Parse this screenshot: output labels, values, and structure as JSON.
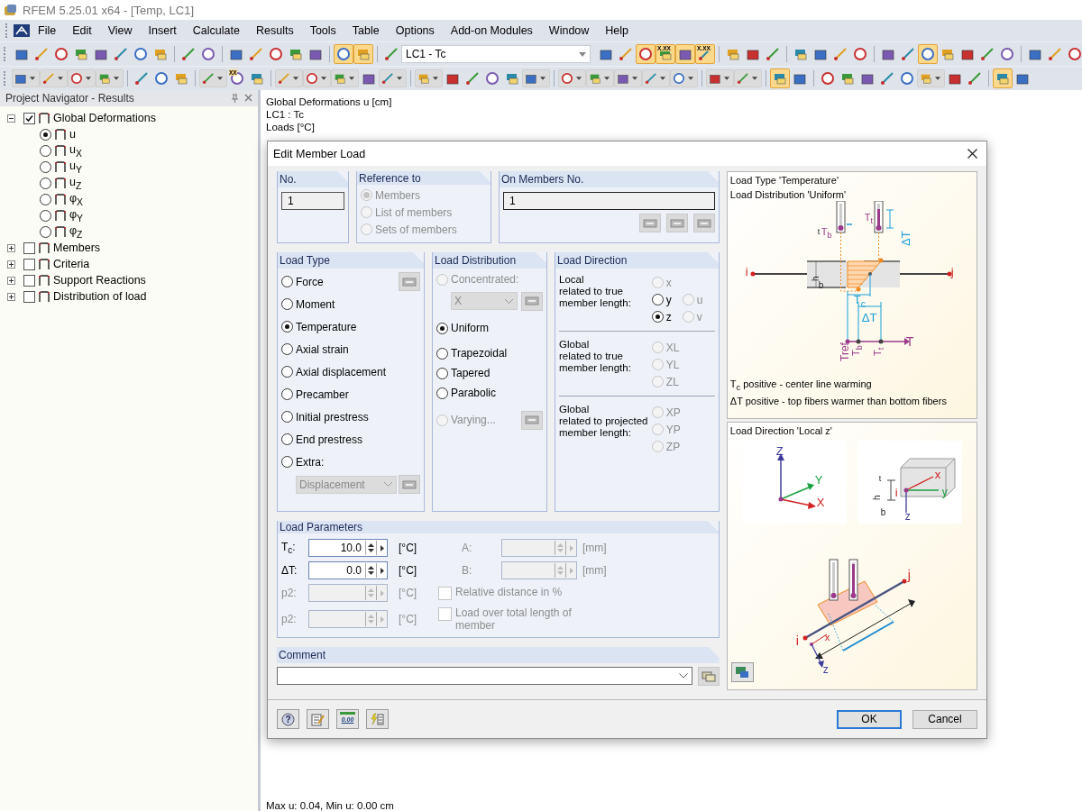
{
  "window": {
    "title": "RFEM 5.25.01 x64 - [Temp, LC1]"
  },
  "menu": [
    "File",
    "Edit",
    "View",
    "Insert",
    "Calculate",
    "Results",
    "Tools",
    "Table",
    "Options",
    "Add-on Modules",
    "Window",
    "Help"
  ],
  "toolbar_1": {
    "before": [
      {
        "kind": "button",
        "pressed": false
      },
      {
        "kind": "button",
        "pressed": false
      },
      {
        "kind": "button",
        "pressed": false
      },
      {
        "kind": "button",
        "pressed": false
      },
      {
        "kind": "button",
        "pressed": false
      },
      {
        "kind": "button",
        "pressed": false
      },
      {
        "kind": "button",
        "pressed": false
      },
      {
        "kind": "button",
        "pressed": false
      },
      {
        "kind": "separator"
      },
      {
        "kind": "button",
        "pressed": false
      },
      {
        "kind": "button",
        "pressed": false
      },
      {
        "kind": "separator"
      },
      {
        "kind": "button",
        "pressed": false
      },
      {
        "kind": "button",
        "pressed": false
      },
      {
        "kind": "button",
        "pressed": false
      },
      {
        "kind": "button",
        "pressed": false
      },
      {
        "kind": "button",
        "pressed": false
      },
      {
        "kind": "separator"
      },
      {
        "kind": "button",
        "pressed": true
      },
      {
        "kind": "button",
        "pressed": true
      },
      {
        "kind": "separator"
      },
      {
        "kind": "button",
        "pressed": false
      }
    ],
    "load_case": "LC1 - Tc",
    "after": [
      {
        "kind": "button",
        "pressed": false
      },
      {
        "kind": "button",
        "pressed": false
      },
      {
        "kind": "button",
        "pressed": true
      },
      {
        "kind": "button",
        "pressed": true,
        "text": "X.XX"
      },
      {
        "kind": "button",
        "pressed": true
      },
      {
        "kind": "button",
        "pressed": true,
        "text": "X.XX"
      },
      {
        "kind": "separator"
      },
      {
        "kind": "button",
        "pressed": false
      },
      {
        "kind": "button",
        "pressed": false
      },
      {
        "kind": "button",
        "pressed": false
      },
      {
        "kind": "separator"
      },
      {
        "kind": "button",
        "pressed": false
      },
      {
        "kind": "button",
        "pressed": false
      },
      {
        "kind": "button",
        "pressed": false
      },
      {
        "kind": "button",
        "pressed": false
      },
      {
        "kind": "separator"
      },
      {
        "kind": "button",
        "pressed": false
      },
      {
        "kind": "button",
        "pressed": false
      },
      {
        "kind": "button",
        "pressed": true
      },
      {
        "kind": "button",
        "pressed": false
      },
      {
        "kind": "button",
        "pressed": false
      },
      {
        "kind": "button",
        "pressed": false
      },
      {
        "kind": "button",
        "pressed": false
      },
      {
        "kind": "separator"
      },
      {
        "kind": "button",
        "pressed": false
      },
      {
        "kind": "button",
        "pressed": false
      },
      {
        "kind": "button",
        "pressed": false
      }
    ]
  },
  "toolbar_2": [
    {
      "kind": "dropdown",
      "pressed": false
    },
    {
      "kind": "dropdown",
      "pressed": false
    },
    {
      "kind": "dropdown",
      "pressed": false
    },
    {
      "kind": "dropdown",
      "pressed": false
    },
    {
      "kind": "separator"
    },
    {
      "kind": "button",
      "pressed": false
    },
    {
      "kind": "button",
      "pressed": false
    },
    {
      "kind": "button",
      "pressed": false
    },
    {
      "kind": "separator"
    },
    {
      "kind": "dropdown",
      "pressed": false
    },
    {
      "kind": "button",
      "pressed": false,
      "text": "XX"
    },
    {
      "kind": "button",
      "pressed": false
    },
    {
      "kind": "separator"
    },
    {
      "kind": "dropdown",
      "pressed": false
    },
    {
      "kind": "dropdown",
      "pressed": false
    },
    {
      "kind": "dropdown",
      "pressed": false
    },
    {
      "kind": "button",
      "pressed": false
    },
    {
      "kind": "dropdown",
      "pressed": false
    },
    {
      "kind": "separator"
    },
    {
      "kind": "dropdown",
      "pressed": false
    },
    {
      "kind": "button",
      "pressed": false
    },
    {
      "kind": "button",
      "pressed": false
    },
    {
      "kind": "button",
      "pressed": false
    },
    {
      "kind": "button",
      "pressed": false
    },
    {
      "kind": "dropdown",
      "pressed": false
    },
    {
      "kind": "separator"
    },
    {
      "kind": "dropdown",
      "pressed": false
    },
    {
      "kind": "dropdown",
      "pressed": false
    },
    {
      "kind": "dropdown",
      "pressed": false
    },
    {
      "kind": "dropdown",
      "pressed": false
    },
    {
      "kind": "dropdown",
      "pressed": false
    },
    {
      "kind": "separator"
    },
    {
      "kind": "dropdown",
      "pressed": false
    },
    {
      "kind": "dropdown",
      "pressed": false
    },
    {
      "kind": "separator"
    },
    {
      "kind": "button",
      "pressed": true
    },
    {
      "kind": "button",
      "pressed": false
    },
    {
      "kind": "separator"
    },
    {
      "kind": "button",
      "pressed": false
    },
    {
      "kind": "button",
      "pressed": false
    },
    {
      "kind": "button",
      "pressed": false
    },
    {
      "kind": "button",
      "pressed": false
    },
    {
      "kind": "button",
      "pressed": false
    },
    {
      "kind": "dropdown",
      "pressed": false
    },
    {
      "kind": "button",
      "pressed": false
    },
    {
      "kind": "button",
      "pressed": false
    },
    {
      "kind": "separator"
    },
    {
      "kind": "button",
      "pressed": true
    },
    {
      "kind": "button",
      "pressed": false
    }
  ],
  "navigator": {
    "title": "Project Navigator - Results",
    "tree": [
      {
        "label": "Global Deformations",
        "checked": true,
        "expanded": true,
        "children": [
          {
            "label": "u",
            "selected": true
          },
          {
            "label": "u$_{X}$",
            "selected": false
          },
          {
            "label": "u$_{Y}$",
            "selected": false
          },
          {
            "label": "u$_{Z}$",
            "selected": false
          },
          {
            "label": "φ$_{X}$",
            "selected": false
          },
          {
            "label": "φ$_{Y}$",
            "selected": false
          },
          {
            "label": "φ$_{Z}$",
            "selected": false
          }
        ]
      },
      {
        "label": "Members",
        "checked": false,
        "expanded": false
      },
      {
        "label": "Criteria",
        "checked": false,
        "expanded": false
      },
      {
        "label": "Support Reactions",
        "checked": false,
        "expanded": false
      },
      {
        "label": "Distribution of load",
        "checked": false,
        "expanded": false
      }
    ]
  },
  "view": {
    "lines": [
      "Global Deformations u [cm]",
      "LC1 : Tc",
      "Loads [°C]"
    ],
    "status": "Max u: 0.04, Min u: 0.00 cm"
  },
  "dialog": {
    "title": "Edit Member Load",
    "no": {
      "title": "No.",
      "value": "1"
    },
    "reference": {
      "title": "Reference to",
      "items": [
        {
          "label": "Members",
          "selected": true,
          "disabled": true
        },
        {
          "label": "List of members",
          "selected": false,
          "disabled": true
        },
        {
          "label": "Sets of members",
          "selected": false,
          "disabled": true
        }
      ]
    },
    "members": {
      "title": "On Members No.",
      "value": "1"
    },
    "load_type": {
      "title": "Load Type",
      "items": [
        {
          "kind": "radio",
          "label": "Force",
          "selected": false,
          "disabled": false
        },
        {
          "kind": "radio",
          "label": "Moment",
          "selected": false,
          "disabled": false
        },
        {
          "kind": "radio",
          "label": "Temperature",
          "selected": true,
          "disabled": false
        },
        {
          "kind": "radio",
          "label": "Axial strain",
          "selected": false,
          "disabled": false
        },
        {
          "kind": "radio",
          "label": "Axial displacement",
          "selected": false,
          "disabled": false
        },
        {
          "kind": "radio",
          "label": "Precamber",
          "selected": false,
          "disabled": false
        },
        {
          "kind": "radio",
          "label": "Initial prestress",
          "selected": false,
          "disabled": false
        },
        {
          "kind": "radio",
          "label": "End prestress",
          "selected": false,
          "disabled": false
        },
        {
          "kind": "radio",
          "label": "Extra:",
          "selected": false,
          "disabled": false
        },
        {
          "kind": "dropdown",
          "value": "Displacement",
          "disabled": true
        }
      ]
    },
    "load_distribution": {
      "title": "Load Distribution",
      "items": [
        {
          "kind": "radio",
          "label": "Concentrated:",
          "selected": false,
          "disabled": true
        },
        {
          "kind": "dropdown",
          "value": "X",
          "disabled": true
        },
        {
          "kind": "radio",
          "label": "Uniform",
          "selected": true,
          "disabled": false
        },
        {
          "kind": "radio",
          "label": "Trapezoidal",
          "selected": false,
          "disabled": false
        },
        {
          "kind": "radio",
          "label": "Tapered",
          "selected": false,
          "disabled": false
        },
        {
          "kind": "radio",
          "label": "Parabolic",
          "selected": false,
          "disabled": false
        },
        {
          "kind": "radio",
          "label": "Varying...",
          "selected": false,
          "disabled": true
        }
      ]
    },
    "load_direction": {
      "title": "Load Direction",
      "groups": [
        {
          "label": "Local\nrelated to true\nmember length:",
          "columns": [
            [
              {
                "label": "x",
                "selected": false,
                "disabled": true
              },
              {
                "label": "y",
                "selected": false,
                "disabled": false
              },
              {
                "label": "z",
                "selected": true,
                "disabled": false
              }
            ],
            [
              {
                "label": "u",
                "selected": false,
                "disabled": true
              },
              {
                "label": "v",
                "selected": false,
                "disabled": true
              }
            ]
          ]
        },
        {
          "label": "Global\nrelated to true\nmember length:",
          "columns": [
            [
              {
                "label": "XL",
                "selected": false,
                "disabled": true
              },
              {
                "label": "YL",
                "selected": false,
                "disabled": true
              },
              {
                "label": "ZL",
                "selected": false,
                "disabled": true
              }
            ]
          ]
        },
        {
          "label": "Global\nrelated to projected\nmember length:",
          "columns": [
            [
              {
                "label": "XP",
                "selected": false,
                "disabled": true
              },
              {
                "label": "YP",
                "selected": false,
                "disabled": true
              },
              {
                "label": "ZP",
                "selected": false,
                "disabled": true
              }
            ]
          ]
        }
      ]
    },
    "parameters": {
      "title": "Load Parameters",
      "fields": [
        {
          "label": "T$_{c}$:",
          "value": "10.0",
          "unit": "[°C]",
          "disabled": false
        },
        {
          "label": "ΔT:",
          "value": "0.0",
          "unit": "[°C]",
          "disabled": false
        },
        {
          "label": "p2:",
          "unit": "[°C]",
          "disabled": true
        },
        {
          "label": "p2:",
          "unit": "[°C]",
          "disabled": true
        }
      ],
      "fields_right": [
        {
          "label": "A:",
          "unit": "[mm]",
          "disabled": true
        },
        {
          "label": "B:",
          "unit": "[mm]",
          "disabled": true
        }
      ],
      "checkboxes": [
        {
          "label": "Relative distance in %",
          "checked": false,
          "disabled": true
        },
        {
          "label": "Load over total length of member",
          "checked": false,
          "disabled": true
        }
      ]
    },
    "comment": {
      "title": "Comment"
    },
    "preview_1": {
      "titles": [
        "Load Type 'Temperature'",
        "Load Distribution 'Uniform'"
      ],
      "labels": [
        "T$_{b}$",
        "T$_{t}$",
        "ΔT",
        "t",
        "h",
        "b",
        "i",
        "j",
        "T$_{c}$",
        "ΔT",
        "T",
        "Tref",
        "T$_{b}$",
        "T$_{t}$"
      ],
      "notes": [
        "T$_{c}$ positive - center line warming",
        "ΔT positive - top fibers warmer than bottom fibers"
      ]
    },
    "preview_2": {
      "title": "Load Direction 'Local z'",
      "labels": [
        "Z",
        "Y",
        "X",
        "t",
        "h",
        "b",
        "i",
        "x",
        "y",
        "z",
        "j",
        "i",
        "x",
        "z"
      ]
    },
    "footer_tools": [
      {
        "kind": "help",
        "text": "?"
      },
      {
        "kind": "edit"
      },
      {
        "kind": "units",
        "text": "0.00"
      },
      {
        "kind": "wizard"
      }
    ],
    "buttons": [
      {
        "label": "OK",
        "default": true
      },
      {
        "label": "Cancel",
        "default": false
      }
    ]
  }
}
